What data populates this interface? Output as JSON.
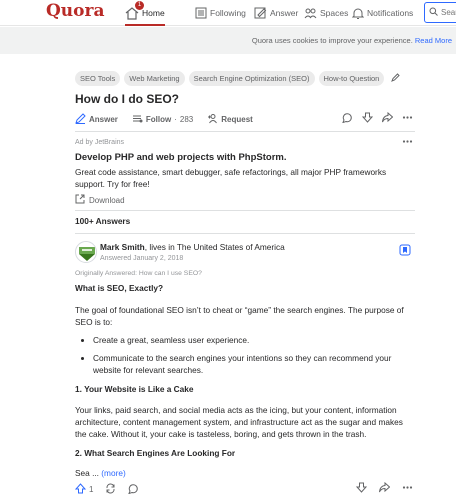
{
  "nav": {
    "logo": "Quora",
    "home_label": "Home",
    "home_badge": "1",
    "following_label": "Following",
    "answer_label": "Answer",
    "spaces_label": "Spaces",
    "notifications_label": "Notifications",
    "search_placeholder": "Sear"
  },
  "cookie": {
    "text": "Quora uses cookies to improve your experience.",
    "link": "Read More"
  },
  "question": {
    "topics": [
      "SEO Tools",
      "Web Marketing",
      "Search Engine Optimization (SEO)",
      "How-to Question"
    ],
    "title": "How do I do SEO?",
    "answer_label": "Answer",
    "follow_label": "Follow",
    "follow_sep": "·",
    "follow_count": "283",
    "request_label": "Request"
  },
  "ad": {
    "by": "Ad by JetBrains",
    "title": "Develop PHP and web projects with PhpStorm.",
    "body": "Great code assistance, smart debugger, safe refactorings, all major PHP frameworks support. Try for free!",
    "download_label": "Download"
  },
  "answers": {
    "count": "100+ Answers"
  },
  "answer": {
    "author": "Mark Smith",
    "author_suffix": ", lives in The United States of America",
    "answered": "Answered January 2, 2018",
    "originally": "Originally Answered: How can I use SEO?",
    "heading1": "What is SEO, Exactly?",
    "para1": "The goal of foundational SEO isn’t to cheat or “game” the search engines. The purpose of SEO is to:",
    "bullet1": "Create a great, seamless user experience.",
    "bullet2": "Communicate to the search engines your intentions so they can recommend your website for relevant searches.",
    "heading2": "1. Your Website is Like a Cake",
    "para2": "Your links, paid search, and social media acts as the icing, but your content, information architecture, content management system, and infrastructure act as the sugar and makes the cake. Without it, your cake is tasteless, boring, and gets thrown in the trash.",
    "heading3": "2. What Search Engines Are Looking For",
    "teaser": "Sea ...",
    "more_label": "(more)",
    "upvote_count": "1"
  },
  "colors": {
    "brand": "#b92b27",
    "link": "#2e69ff"
  }
}
